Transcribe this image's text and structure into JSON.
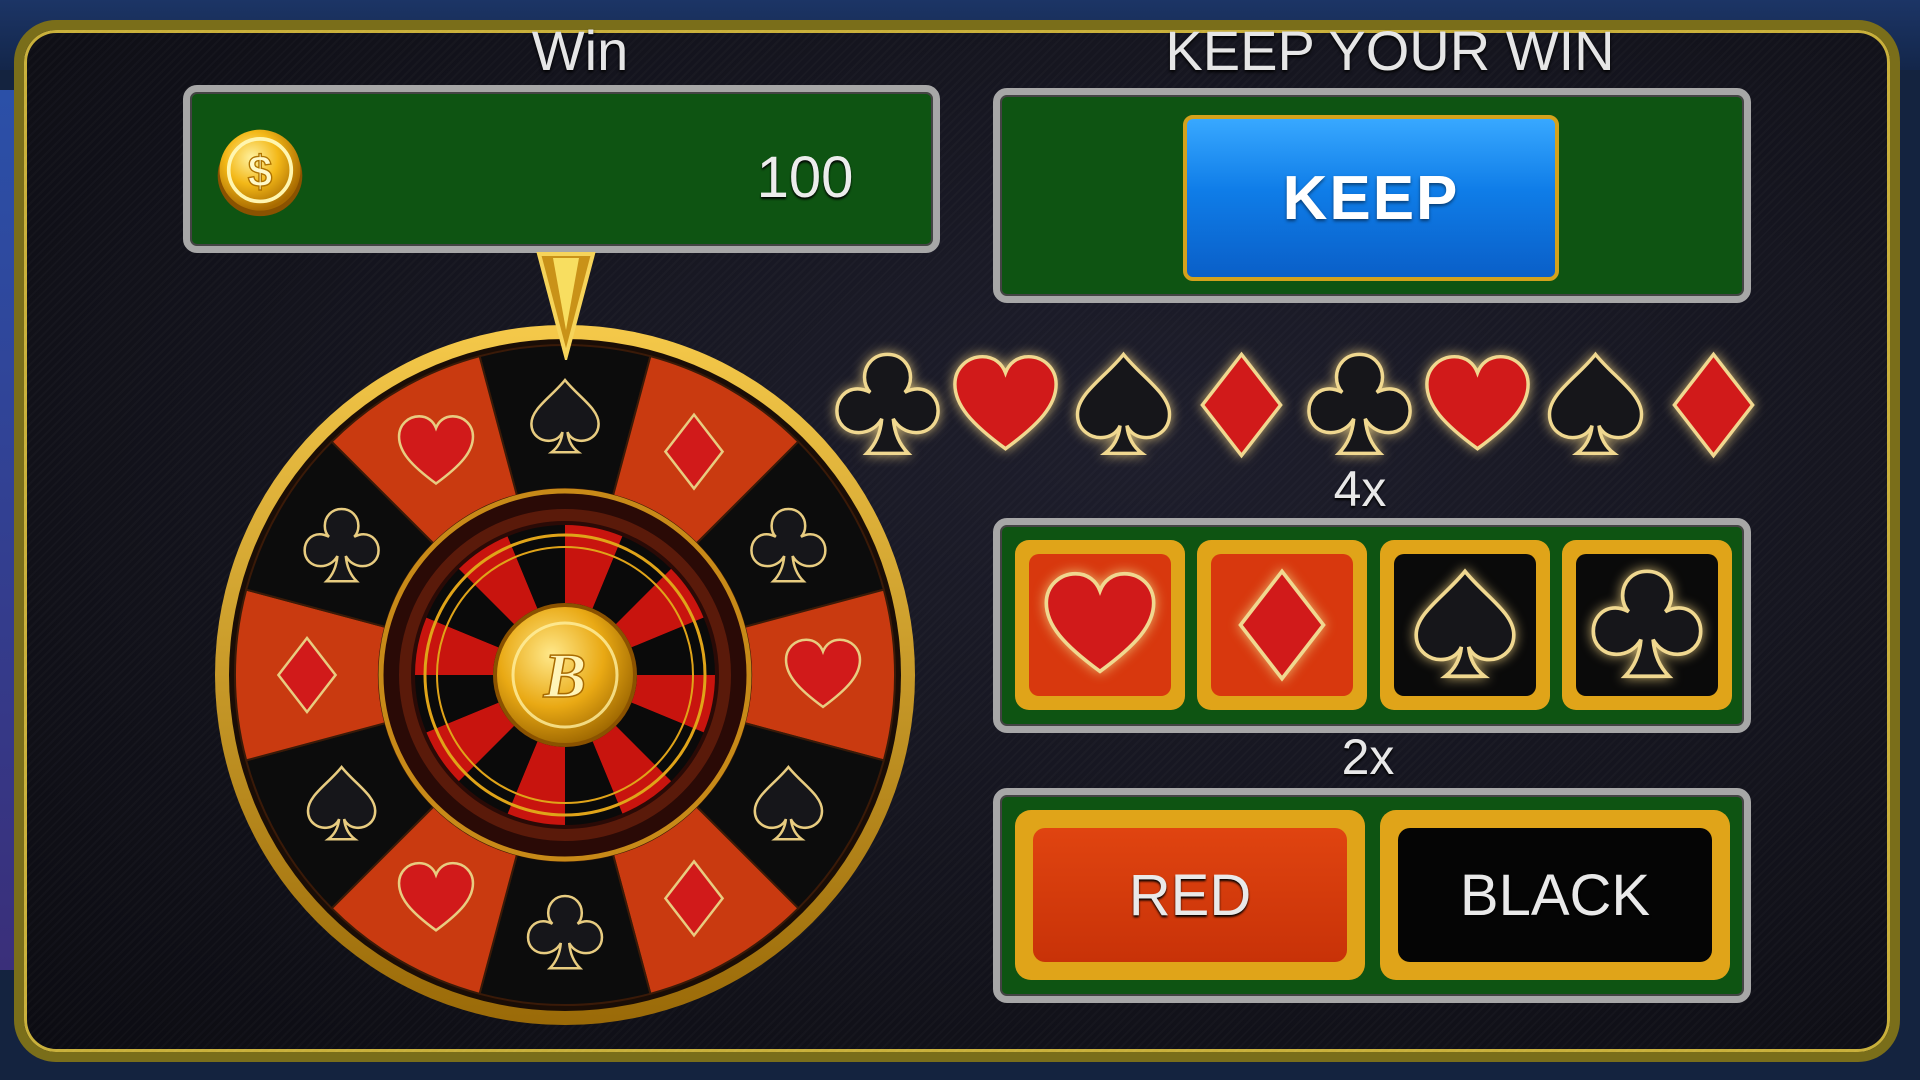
{
  "win": {
    "label": "Win",
    "value": "100",
    "coin_symbol": "$"
  },
  "keep": {
    "label": "KEEP YOUR WIN",
    "button": "KEEP"
  },
  "history": [
    "club",
    "heart",
    "spade",
    "diamond",
    "club",
    "heart",
    "spade",
    "diamond"
  ],
  "suit_bet": {
    "multiplier": "4x",
    "options": [
      "heart",
      "diamond",
      "spade",
      "club"
    ]
  },
  "color_bet": {
    "multiplier": "2x",
    "red": "RED",
    "black": "BLACK"
  },
  "wheel": {
    "center_letter": "B",
    "segments": [
      "spade",
      "diamond",
      "club",
      "heart",
      "spade",
      "diamond",
      "club",
      "heart",
      "spade",
      "diamond",
      "club",
      "heart"
    ]
  },
  "colors": {
    "red_suit": "#d11a1a",
    "black_suit": "#16161a",
    "panel_green": "#0e5412",
    "gold": "#e0a419",
    "keep_blue": "#0f7de8"
  }
}
